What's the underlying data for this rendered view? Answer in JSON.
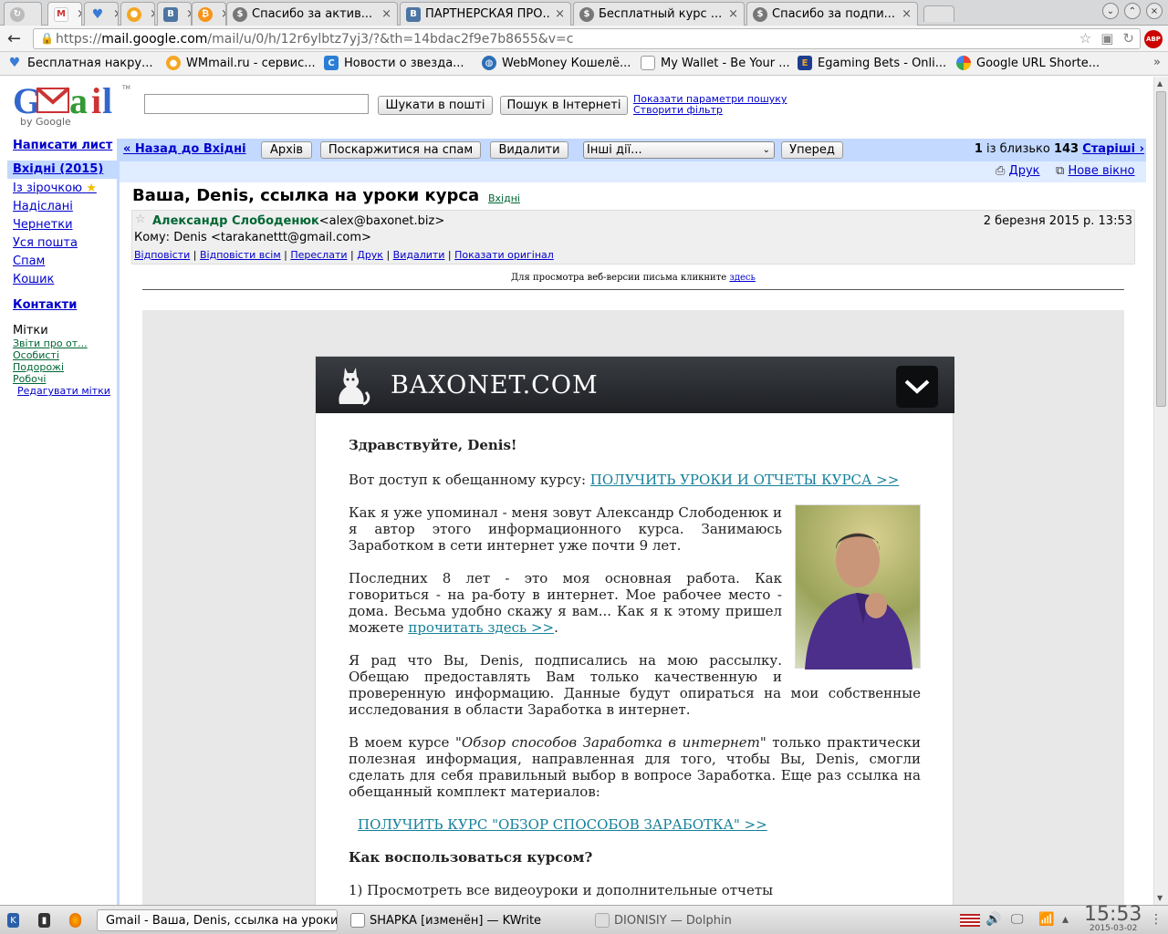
{
  "browser": {
    "tabs": [
      {
        "title": "",
        "icon": "reload-icon"
      },
      {
        "title": "",
        "icon": "gmail-icon",
        "active": true
      },
      {
        "title": "",
        "icon": "heart-icon"
      },
      {
        "title": "",
        "icon": "coin-icon"
      },
      {
        "title": "",
        "icon": "vk-icon"
      },
      {
        "title": "",
        "icon": "bitcoin-icon"
      },
      {
        "title": "Спасибо за актив...",
        "icon": "dollar-icon"
      },
      {
        "title": "ПАРТНЕРСКАЯ ПРО...",
        "icon": "vk-icon"
      },
      {
        "title": "Бесплатный курс ...",
        "icon": "dollar-icon"
      },
      {
        "title": "Спасибо за подпи...",
        "icon": "dollar-icon"
      }
    ],
    "url": "https://mail.google.com/mail/u/0/h/12r6ylbtz7yj3/?&th=14bdac2f9e7b8655&v=c",
    "url_host": "mail.google.com",
    "url_prefix": "https://",
    "url_suffix": "/mail/u/0/h/12r6ylbtz7yj3/?&th=14bdac2f9e7b8655&v=c",
    "adblock_label": "ABP",
    "bookmarks": [
      {
        "label": "Бесплатная накру...",
        "icon": "heart-icon"
      },
      {
        "label": "WMmail.ru - сервис...",
        "icon": "coin-icon"
      },
      {
        "label": "Новости о звезда...",
        "icon": "c-icon"
      },
      {
        "label": "WebMoney Кошелё...",
        "icon": "globe-icon"
      },
      {
        "label": "My Wallet - Be Your ...",
        "icon": "page-icon"
      },
      {
        "label": "Egaming Bets - Onli...",
        "icon": "e-icon"
      },
      {
        "label": "Google URL Shorte...",
        "icon": "google-icon"
      }
    ],
    "bookmarks_more": "»"
  },
  "gmail": {
    "logo_text": "Gmail",
    "logo_by": "by Google",
    "search_mail_button": "Шукати в пошті",
    "search_web_button": "Пошук в Інтернеті",
    "show_search_options": "Показати параметри пошуку",
    "create_filter": "Створити фільтр",
    "nav": {
      "compose": "Написати лист",
      "inbox": "Вхідні (2015)",
      "starred": "Із зірочкою",
      "sent": "Надіслані",
      "drafts": "Чернетки",
      "all_mail": "Уся пошта",
      "spam": "Спам",
      "trash": "Кошик",
      "contacts": "Контакти",
      "labels_title": "Мітки",
      "labels": [
        "Звіти про от...",
        "Особисті",
        "Подорожі",
        "Робочі"
      ],
      "edit_labels": "Редагувати мітки"
    },
    "actions": {
      "back_to_inbox": "« Назад до Вхідні",
      "archive": "Архів",
      "report_spam": "Поскаржитися на спам",
      "delete": "Видалити",
      "more_actions": "Інші дії...",
      "forward_nav": "Уперед",
      "paging_current": "1",
      "paging_middle": " із близько ",
      "paging_total": "143",
      "older": "Старіші ›",
      "print": "Друк",
      "new_window": "Нове вікно"
    },
    "message": {
      "subject": "Ваша, Denis, ссылка на уроки курса",
      "subject_label": "Вхідні",
      "sender_name": "Александр Слободенюк",
      "sender_email": "<alex@baxonet.biz>",
      "date": "2 березня 2015 р. 13:53",
      "to": "Кому: Denis <tarakanettt@gmail.com>",
      "links": [
        "Відповісти",
        "Відповісти всім",
        "Переслати",
        "Друк",
        "Видалити",
        "Показати оригінал"
      ],
      "webversion_text": "Для просмотра веб-версии письма кликните ",
      "webversion_link": "здесь"
    }
  },
  "email": {
    "brand": "BAXONET.COM",
    "greeting": "Здравствуйте, Denis!",
    "access_text": "Вот доступ к обещанному курсу:  ",
    "access_link": "ПОЛУЧИТЬ УРОКИ И ОТЧЕТЫ КУРСА >>",
    "p1": "Как я уже упоминал - меня зовут Александр Слободенюк и я автор этого информационного курса. Занимаюсь Заработком в сети интернет уже почти 9 лет.",
    "p2_text": "Последних 8 лет - это моя основная работа. Как говориться - на ра-боту в интернет. Мое рабочее место - дома. Весьма удобно скажу я вам... Как я к этому пришел можете ",
    "p2_link": "прочитать здесь >>",
    "p2_end": ".",
    "p3": "Я рад что Вы, Denis, подписались на мою рассылку. Обещаю предоставлять Вам только качественную и проверенную информацию. Данные будут опираться на мои собственные исследования в  области Заработка в интернет.",
    "p4_pre": "В моем курсе \"",
    "p4_em": "Обзор способов Заработка в интернет",
    "p4_post": "\" только практически полезная информация, направленная для того, чтобы Вы, Denis, смогли сделать для себя правильный выбор в вопросе Заработка. Еще раз ссылка на обещанный комплект материалов:",
    "course_link": "ПОЛУЧИТЬ  КУРС \"ОБЗОР СПОСОБОВ ЗАРАБОТКА\" >>",
    "howto_title": "Как воспользоваться курсом?",
    "step1": "1) Просмотреть все видеоуроки и дополнительные отчеты"
  },
  "taskbar": {
    "windows": [
      {
        "label": "Gmail - Ваша, Denis, ссылка на уроки",
        "active": true
      },
      {
        "label": "SHAPKA [изменён] — KWrite"
      },
      {
        "label": "DIONISIY — Dolphin"
      }
    ],
    "time": "15:53",
    "date": "2015-03-02"
  },
  "colors": {
    "gmail_blue_bar": "#c3d9ff",
    "gmail_light_bar": "#e0ecff",
    "link_blue": "#0000cc",
    "label_green": "#006633",
    "email_link": "#15809a",
    "email_header": "#1e2024"
  }
}
